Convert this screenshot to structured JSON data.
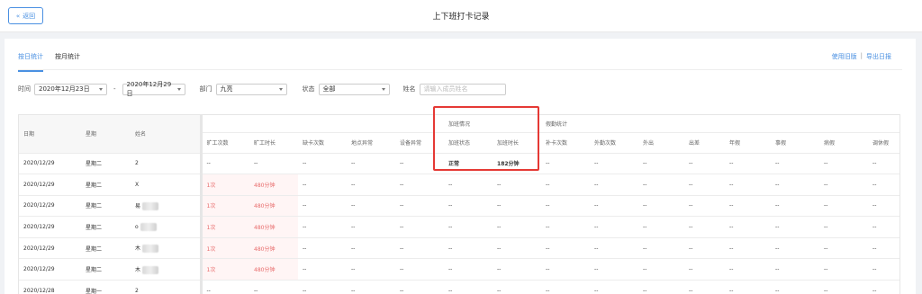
{
  "header": {
    "back_label": "返回",
    "title": "上下班打卡记录"
  },
  "tabs": [
    {
      "label": "按日统计"
    },
    {
      "label": "按月统计"
    }
  ],
  "top_links": {
    "old_version": "使用旧版",
    "separator": "|",
    "export": "导出日报"
  },
  "filters": {
    "time_label": "时间",
    "start_date": "2020年12月23日",
    "end_date": "2020年12月29日",
    "date_sep": "-",
    "dept_label": "部门",
    "dept_value": "九亮",
    "status_label": "状态",
    "status_value": "全部",
    "name_label": "姓名",
    "name_placeholder": "请输入成员姓名"
  },
  "table": {
    "fixed_headers": {
      "date": "日期",
      "weekday": "星期",
      "name": "姓名"
    },
    "group_headers": {
      "overtime": "加班情况",
      "attendance": "假勤统计"
    },
    "columns": [
      "旷工次数",
      "旷工时长",
      "缺卡次数",
      "地点异常",
      "设备异常",
      "加班状态",
      "加班时长",
      "补卡次数",
      "外勤次数",
      "外出",
      "出差",
      "年假",
      "事假",
      "病假",
      "调休假"
    ],
    "rows": [
      {
        "date": "2020/12/29",
        "weekday": "星期二",
        "name": "2",
        "masked": false,
        "values": [
          "--",
          "--",
          "--",
          "--",
          "--",
          "正常",
          "182分钟",
          "--",
          "--",
          "--",
          "--",
          "--",
          "--",
          "--",
          "--"
        ]
      },
      {
        "date": "2020/12/29",
        "weekday": "星期二",
        "name": "X",
        "masked": false,
        "values": [
          "1次",
          "480分钟",
          "--",
          "--",
          "--",
          "--",
          "--",
          "--",
          "--",
          "--",
          "--",
          "--",
          "--",
          "--",
          "--"
        ]
      },
      {
        "date": "2020/12/29",
        "weekday": "星期二",
        "name": "易",
        "masked": true,
        "values": [
          "1次",
          "480分钟",
          "--",
          "--",
          "--",
          "--",
          "--",
          "--",
          "--",
          "--",
          "--",
          "--",
          "--",
          "--",
          "--"
        ]
      },
      {
        "date": "2020/12/29",
        "weekday": "星期二",
        "name": "o",
        "masked": true,
        "values": [
          "1次",
          "480分钟",
          "--",
          "--",
          "--",
          "--",
          "--",
          "--",
          "--",
          "--",
          "--",
          "--",
          "--",
          "--",
          "--"
        ]
      },
      {
        "date": "2020/12/29",
        "weekday": "星期二",
        "name": "木",
        "masked": true,
        "values": [
          "1次",
          "480分钟",
          "--",
          "--",
          "--",
          "--",
          "--",
          "--",
          "--",
          "--",
          "--",
          "--",
          "--",
          "--",
          "--"
        ]
      },
      {
        "date": "2020/12/29",
        "weekday": "星期二",
        "name": "木",
        "masked": true,
        "values": [
          "1次",
          "480分钟",
          "--",
          "--",
          "--",
          "--",
          "--",
          "--",
          "--",
          "--",
          "--",
          "--",
          "--",
          "--",
          "--"
        ]
      },
      {
        "date": "2020/12/28",
        "weekday": "星期一",
        "name": "2",
        "masked": false,
        "values": [
          "--",
          "--",
          "--",
          "--",
          "--",
          "--",
          "--",
          "--",
          "--",
          "--",
          "--",
          "--",
          "--",
          "--",
          "--"
        ]
      }
    ]
  },
  "colors": {
    "accent": "#4a90e2",
    "absent_text": "#e86a6a",
    "absent_bg": "#fff5f5",
    "highlight": "#e53935"
  }
}
